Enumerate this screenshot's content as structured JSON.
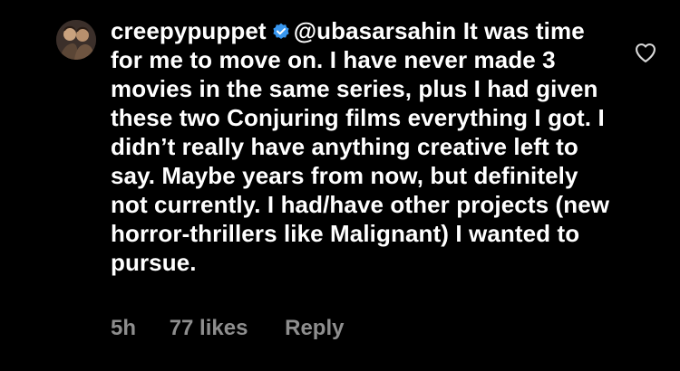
{
  "comment": {
    "username": "creepypuppet",
    "verified_icon": "verified-badge-icon",
    "mention": "@ubasarsahin",
    "text": " It was time for me to move on. I have never made 3 movies in the same series, plus I had given these two Conjuring films everything I got. I didn’t really have anything creative left to say. Maybe years from now, but definitely not currently. I had/have other projects (new horror-thrillers like Malignant) I wanted to pursue.",
    "like_icon": "heart-outline-icon",
    "avatar_icon": "user-avatar"
  },
  "meta": {
    "time": "5h",
    "likes": "77 likes",
    "reply": "Reply"
  },
  "colors": {
    "background": "#000000",
    "text": "#ffffff",
    "muted": "#8e8e8e",
    "verified": "#3897f0"
  }
}
